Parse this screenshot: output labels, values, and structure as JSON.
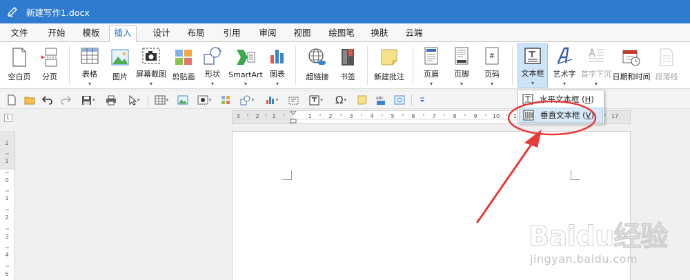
{
  "titlebar": {
    "document_title": "新建写作1.docx"
  },
  "menu": {
    "tabs": [
      "文件",
      "开始",
      "模板",
      "插入",
      "设计",
      "布局",
      "引用",
      "审阅",
      "视图",
      "绘图笔",
      "换肤",
      "云端"
    ],
    "active": "插入"
  },
  "ribbon": {
    "blank_page": "空白页",
    "page_break": "分页",
    "table": "表格",
    "picture": "图片",
    "screenshot": "屏幕截图",
    "clip_art": "剪贴画",
    "shapes": "形状",
    "smartart": "SmartArt",
    "chart": "图表",
    "hyperlink": "超链接",
    "bookmark": "书签",
    "new_comment": "新建批注",
    "header": "页眉",
    "footer": "页脚",
    "page_number": "页码",
    "textbox": "文本框",
    "wordart": "艺术字",
    "drop_cap": "首字下沉",
    "date_time": "日期和时间",
    "paragraph_line": "段落线"
  },
  "ruler": {
    "h_labels": [
      "3",
      "2",
      "1",
      "1",
      "2",
      "3",
      "4",
      "5",
      "6",
      "7",
      "8",
      "9",
      "10",
      "11",
      "17"
    ],
    "v_labels": [
      "2",
      "1",
      "0",
      "1",
      "2",
      "3",
      "4",
      "5"
    ]
  },
  "dropdown": {
    "horizontal": {
      "label": "水平文本框 (",
      "key": "H",
      "end": ")"
    },
    "vertical": {
      "label": "垂直文本框 (",
      "key": "V",
      "end": ")"
    }
  },
  "watermark": {
    "brand": "Baidu经验",
    "url": "jingyan.baidu.com"
  },
  "colors": {
    "title_bar": "#2f7bd1",
    "active_tab_text": "#2a6fc4",
    "annotation_red": "#e8393a",
    "selected_bg": "#cde3f7"
  }
}
